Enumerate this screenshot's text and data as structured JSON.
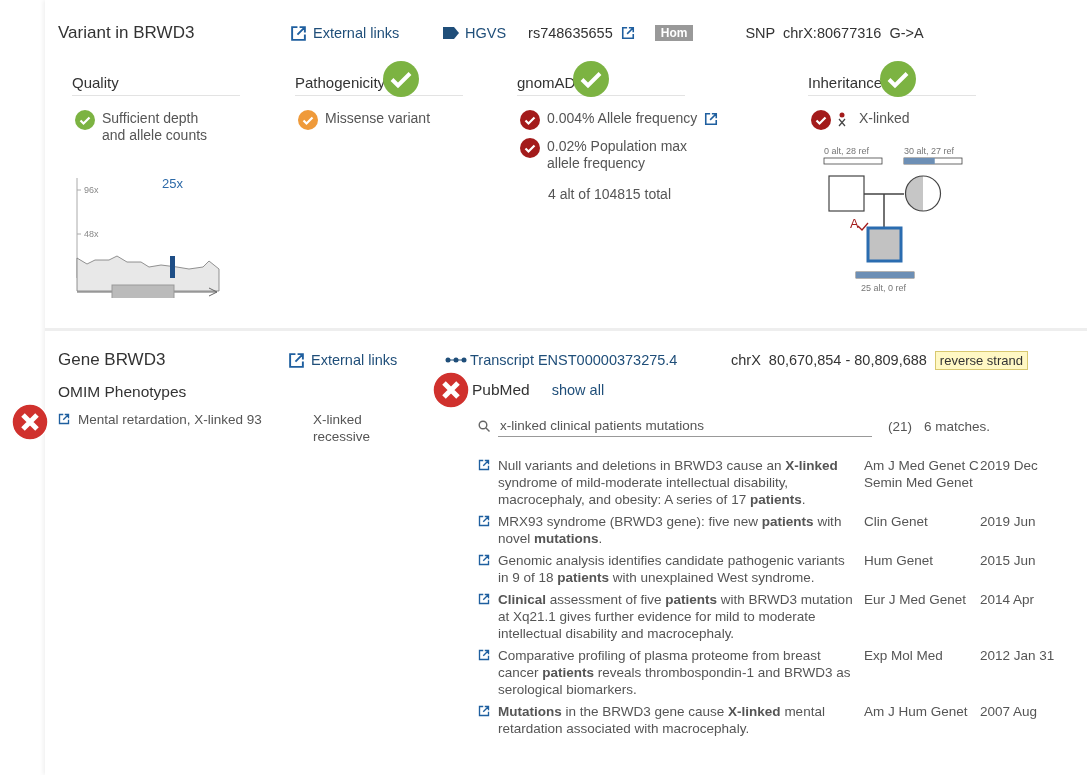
{
  "variant": {
    "title": "Variant in BRWD3",
    "external_links": "External links",
    "hgvs": "HGVS",
    "rsid": "rs748635655",
    "zygosity": "Hom",
    "snp": "SNP  chrX:80677316  G->A"
  },
  "criteria": [
    {
      "kind": "quality",
      "title": "Quality",
      "approved": false,
      "items": [
        {
          "kind": "text",
          "color": "#7cb342",
          "text": "Sufficient depth and allele counts"
        }
      ],
      "depth": {
        "ticks": [
          "96x",
          "48x"
        ],
        "reading": "25x"
      }
    },
    {
      "kind": "plain",
      "title": "Pathogenicity",
      "approved": true,
      "items": [
        {
          "kind": "text",
          "color": "#ef9a3a",
          "text": "Missense variant"
        }
      ]
    },
    {
      "kind": "frequency",
      "title": "gnomAD",
      "approved": true,
      "items": [
        {
          "kind": "link",
          "color": "#a31b1b",
          "text": "0.004% Allele frequency"
        },
        {
          "kind": "text",
          "color": "#a31b1b",
          "text": "0.02% Population max allele frequency"
        }
      ],
      "note": "4 alt of 104815 total"
    },
    {
      "kind": "inheritance",
      "title": "Inheritance",
      "approved": true,
      "items": [
        {
          "kind": "mode",
          "color": "#a31b1b",
          "text": "X-linked"
        }
      ],
      "pedigree": {
        "father": {
          "label": "0 alt, 28 ref"
        },
        "mother": {
          "label": "30 alt, 27 ref"
        },
        "child": {
          "label": "25 alt, 0 ref"
        },
        "mark": "A"
      }
    }
  ],
  "gene": {
    "title": "Gene BRWD3",
    "external_links": "External links",
    "transcript": "Transcript ENST00000373275.4",
    "chrom": "chrX",
    "range": "80,670,854 - 80,809,688",
    "strand": "reverse strand"
  },
  "omim": {
    "title": "OMIM Phenotypes",
    "failed": true,
    "rows": [
      {
        "name": "Mental retardation, X-linked 93",
        "inheritance": "X-linked recessive"
      }
    ]
  },
  "pubmed": {
    "title": "PubMed",
    "failed": true,
    "show_all": "show all",
    "search": "x-linked clinical patients mutations",
    "count": "(21)",
    "matches": "6 matches.",
    "articles": [
      {
        "title": "Null variants and deletions in BRWD3 cause an **X-linked** syndrome of mild-moderate intellectual disability, macrocephaly, and obesity: A series of 17 **patients**.",
        "journal": "Am J Med Genet C Semin Med Genet",
        "date": "2019 Dec"
      },
      {
        "title": "MRX93 syndrome (BRWD3 gene): five new **patients** with novel **mutations**.",
        "journal": "Clin Genet",
        "date": "2019 Jun"
      },
      {
        "title": "Genomic analysis identifies candidate pathogenic variants in 9 of 18 **patients** with unexplained West syndrome.",
        "journal": "Hum Genet",
        "date": "2015 Jun"
      },
      {
        "title": "**Clinical** assessment of five **patients** with BRWD3 mutation at Xq21.1 gives further evidence for mild to moderate intellectual disability and macrocephaly.",
        "journal": "Eur J Med Genet",
        "date": "2014 Apr"
      },
      {
        "title": "Comparative profiling of plasma proteome from breast cancer **patients** reveals thrombospondin-1 and BRWD3 as serological biomarkers.",
        "journal": "Exp Mol Med",
        "date": "2012 Jan 31"
      },
      {
        "title": "**Mutations** in the BRWD3 gene cause **X-linked** mental retardation associated with macrocephaly.",
        "journal": "Am J Hum Genet",
        "date": "2007 Aug"
      }
    ]
  }
}
